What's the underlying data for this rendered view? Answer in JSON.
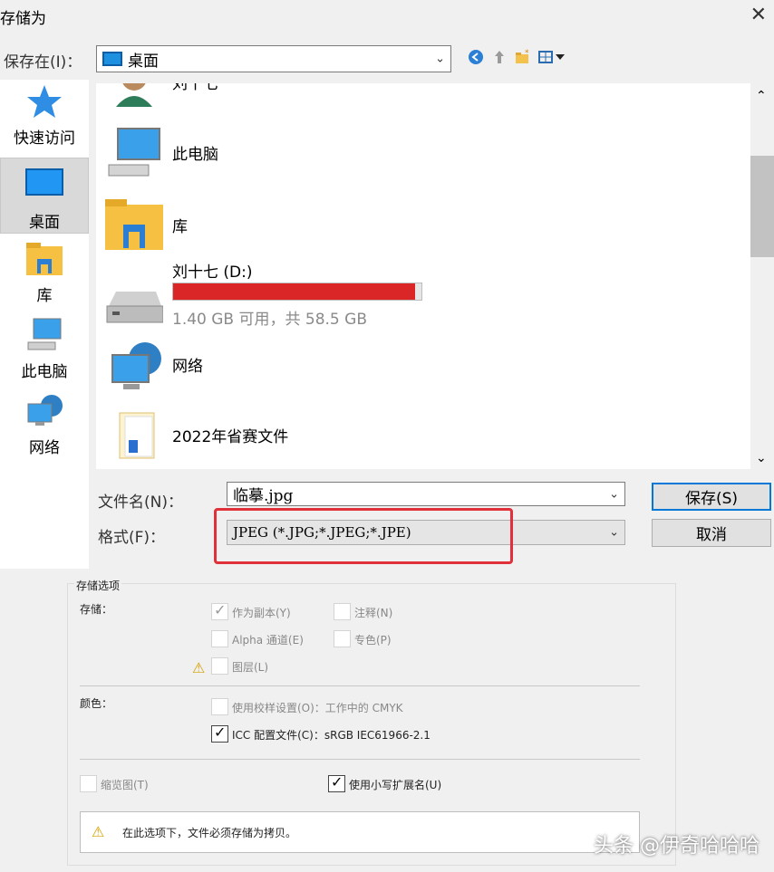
{
  "dialog": {
    "title": "存储为"
  },
  "toolbar": {
    "save_in_label": "保存在(I)：",
    "location_value": "桌面",
    "icons": [
      "back-icon",
      "up-folder-icon",
      "new-folder-icon",
      "view-menu-icon"
    ]
  },
  "places": [
    {
      "label": "快速访问",
      "icon": "star-icon"
    },
    {
      "label": "桌面",
      "icon": "desktop-icon"
    },
    {
      "label": "库",
      "icon": "library-icon"
    },
    {
      "label": "此电脑",
      "icon": "computer-icon"
    },
    {
      "label": "网络",
      "icon": "network-icon"
    }
  ],
  "files": [
    {
      "name": "刘十七",
      "icon": "user-icon"
    },
    {
      "name": "此电脑",
      "icon": "computer-icon"
    },
    {
      "name": "库",
      "icon": "library-icon"
    },
    {
      "name": "刘十七 (D:)",
      "usage": "1.40 GB 可用，共 58.5 GB",
      "used_fraction": 0.976,
      "bar_color": "#da2626",
      "icon": "drive-icon"
    },
    {
      "name": "网络",
      "icon": "network-icon"
    },
    {
      "name": "2022年省赛文件",
      "icon": "folder-icon"
    }
  ],
  "fields": {
    "filename_label": "文件名(N)：",
    "filename_value": "临摹.jpg",
    "format_label": "格式(F)：",
    "format_value": "JPEG (*.JPG;*.JPEG;*.JPE)"
  },
  "buttons": {
    "save": "保存(S)",
    "cancel": "取消"
  },
  "options": {
    "group_title": "存储选项",
    "store_label": "存储：",
    "as_copy": "作为副本(Y)",
    "notes": "注释(N)",
    "alpha": "Alpha 通道(E)",
    "spot": "专色(P)",
    "layers": "图层(L)",
    "color_label": "颜色：",
    "proof": "使用校样设置(O)：工作中的 CMYK",
    "icc": "ICC 配置文件(C)：sRGB IEC61966-2.1",
    "thumbnail": "缩览图(T)",
    "lowercase_ext": "使用小写扩展名(U)",
    "info": "在此选项下，文件必须存储为拷贝。"
  },
  "watermark": "头条 @伊奇哈哈哈",
  "colors": {
    "accent": "#0078d7",
    "highlight_box": "#e0303a"
  }
}
